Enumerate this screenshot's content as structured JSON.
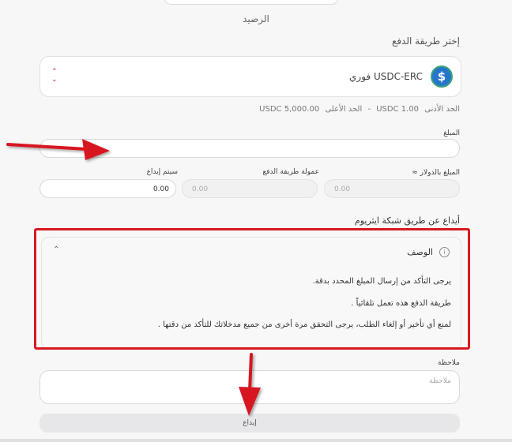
{
  "balance": {
    "label": "الرصيد"
  },
  "payment_method": {
    "section_label": "إختر طريقة الدفع",
    "selected": "USDC-ERC فوري",
    "coin_icon": "usdc-coin-icon",
    "chevron_icon": "up-down-chevron-icon"
  },
  "limits": {
    "min_label": "الحد الأدنى",
    "min_value": "1.00 USDC",
    "separator": "-",
    "max_label": "الحد الأعلى",
    "max_value": "5,000.00 USDC"
  },
  "amount": {
    "label": "المبلغ",
    "value": ""
  },
  "usd_amount": {
    "label": "المبلغ بالدولار ≈",
    "value": "0.00"
  },
  "fee": {
    "label": "عمولة طريقة الدفع",
    "value": "0.00"
  },
  "deposit_received": {
    "label": "سيتم إيداع",
    "value": "0.00"
  },
  "network_title": "أيداع عن طريق شبكة ايثريوم",
  "description": {
    "title": "الوصف",
    "lines": [
      "يرجى التأكد من إرسال المبلغ المحدد بدقة.",
      "طريقة الدفع هذه تعمل تلقائياً .",
      "لمنع أي تأخير أو إلغاء الطلب، يرجى التحقق مرة أخرى من جميع مدخلاتك للتأكد من دقتها ."
    ]
  },
  "notes": {
    "label": "ملاحظة",
    "placeholder": "ملاحظة"
  },
  "deposit_button": {
    "label": "إيداع"
  },
  "annotation_color": "#d71920"
}
